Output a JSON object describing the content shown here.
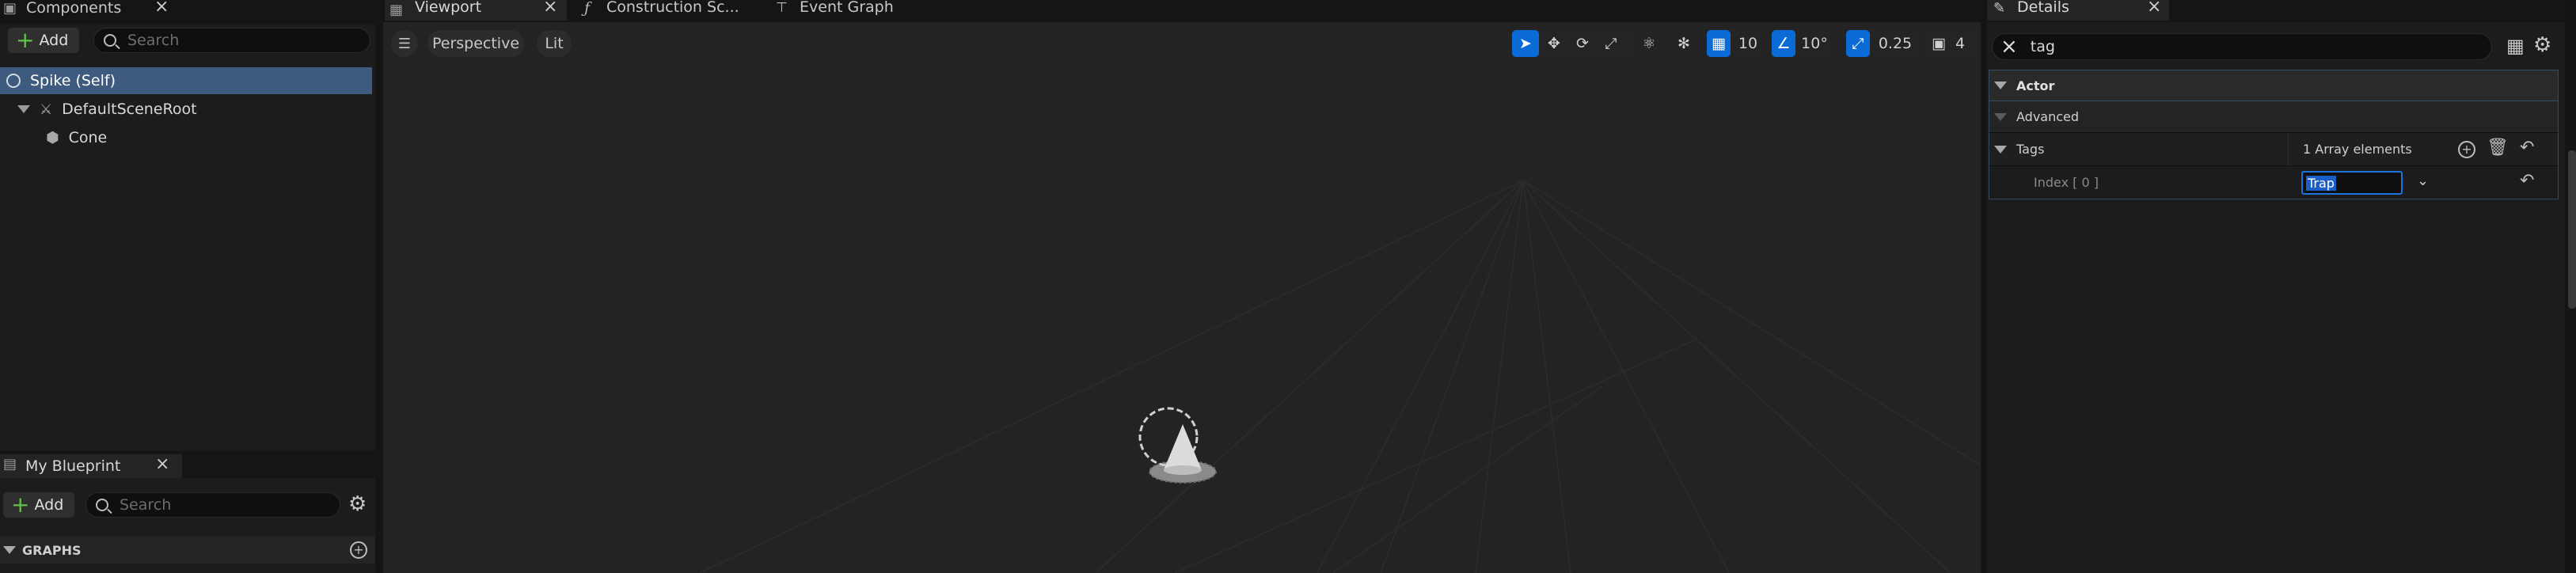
{
  "components_panel": {
    "tab_label": "Components",
    "add_label": "Add",
    "search_placeholder": "Search",
    "tree": [
      {
        "label": "Spike (Self)",
        "selected": true
      },
      {
        "label": "DefaultSceneRoot"
      },
      {
        "label": "Cone"
      }
    ]
  },
  "my_blueprint_panel": {
    "tab_label": "My Blueprint",
    "add_label": "Add",
    "search_placeholder": "Search",
    "section_graphs": "GRAPHS"
  },
  "editor_tabs": [
    {
      "label": "Viewport",
      "active": true
    },
    {
      "label": "Construction Sc..."
    },
    {
      "label": "Event Graph"
    }
  ],
  "viewport": {
    "view_mode": "Perspective",
    "lighting_mode": "Lit",
    "grid_snap": "10",
    "rotation_snap": "10°",
    "scale_snap": "0.25",
    "camera_speed": "4"
  },
  "details_panel": {
    "tab_label": "Details",
    "search_value": "tag",
    "categories": {
      "actor": "Actor",
      "advanced": "Advanced"
    },
    "tags_row": {
      "label": "Tags",
      "value": "1 Array elements"
    },
    "index_row": {
      "label": "Index [ 0 ]",
      "value": "Trap"
    }
  },
  "colors": {
    "accent_blue": "#0a6bd6",
    "selected_row": "#3e5a7e",
    "add_plus": "#60c24a"
  }
}
